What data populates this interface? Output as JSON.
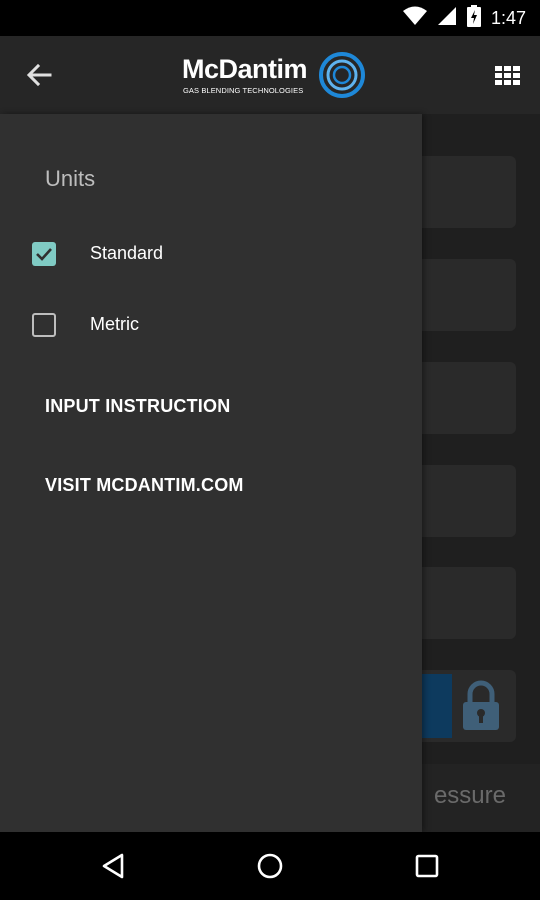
{
  "status_bar": {
    "time": "1:47",
    "icons": [
      "wifi-icon",
      "cell-signal-icon",
      "battery-charging-icon"
    ]
  },
  "toolbar": {
    "back_icon": "arrow-back-icon",
    "logo_name": "McDantim",
    "logo_tagline": "GAS BLENDING TECHNOLOGIES",
    "menu_icon": "grid-apps-icon"
  },
  "drawer": {
    "section_title": "Units",
    "options": [
      {
        "label": "Standard",
        "checked": true
      },
      {
        "label": "Metric",
        "checked": false
      }
    ],
    "links": [
      {
        "label": "INPUT INSTRUCTION"
      },
      {
        "label": "VISIT MCDANTIM.COM"
      }
    ]
  },
  "background": {
    "bottom_label": "essure"
  },
  "colors": {
    "toolbar": "#262626",
    "drawer": "#303030",
    "checkbox_accent": "#80cbc4",
    "logo_blue": "#1e88d8"
  },
  "nav_bar": {
    "icons": [
      "back-triangle-icon",
      "home-circle-icon",
      "recents-square-icon"
    ]
  }
}
